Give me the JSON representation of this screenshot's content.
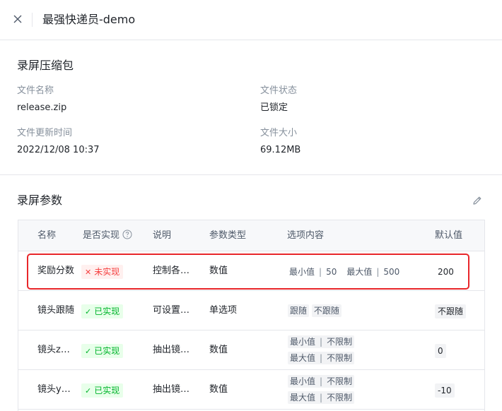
{
  "header": {
    "title": "最强快递员-demo",
    "close_icon": "close-icon"
  },
  "package": {
    "section_title": "录屏压缩包",
    "fields": [
      {
        "label": "文件名称",
        "value": "release.zip"
      },
      {
        "label": "文件状态",
        "value": "已锁定"
      },
      {
        "label": "文件更新时间",
        "value": "2022/12/08 10:37"
      },
      {
        "label": "文件大小",
        "value": "69.12MB"
      }
    ]
  },
  "params": {
    "section_title": "录屏参数",
    "edit_icon": "pencil-icon",
    "columns": [
      "名称",
      "是否实现",
      "说明",
      "参数类型",
      "选项内容",
      "默认值"
    ],
    "rows": [
      {
        "name": "奖励分数",
        "status": "未实现",
        "status_kind": "not-implemented",
        "desc": "控制各…",
        "type": "数值",
        "options_line1": [
          "最小值",
          "50",
          "最大值",
          "500"
        ],
        "default": "200"
      },
      {
        "name": "镜头跟随",
        "status": "已实现",
        "status_kind": "implemented",
        "desc": "可设置…",
        "type": "单选项",
        "options_line1": [
          "跟随",
          "不跟随"
        ],
        "default": "不跟随"
      },
      {
        "name": "镜头z…",
        "status": "已实现",
        "status_kind": "implemented",
        "desc": "抽出镜…",
        "type": "数值",
        "options_line1": [
          "最小值",
          "不限制"
        ],
        "options_line2": [
          "最大值",
          "不限制"
        ],
        "default": "0"
      },
      {
        "name": "镜头y…",
        "status": "已实现",
        "status_kind": "implemented",
        "desc": "抽出镜…",
        "type": "数值",
        "options_line1": [
          "最小值",
          "不限制"
        ],
        "options_line2": [
          "最大值",
          "不限制"
        ],
        "default": "-10"
      }
    ]
  },
  "colors": {
    "highlight": "#e8262a",
    "success": "#00b42a",
    "danger": "#f53f3f"
  }
}
